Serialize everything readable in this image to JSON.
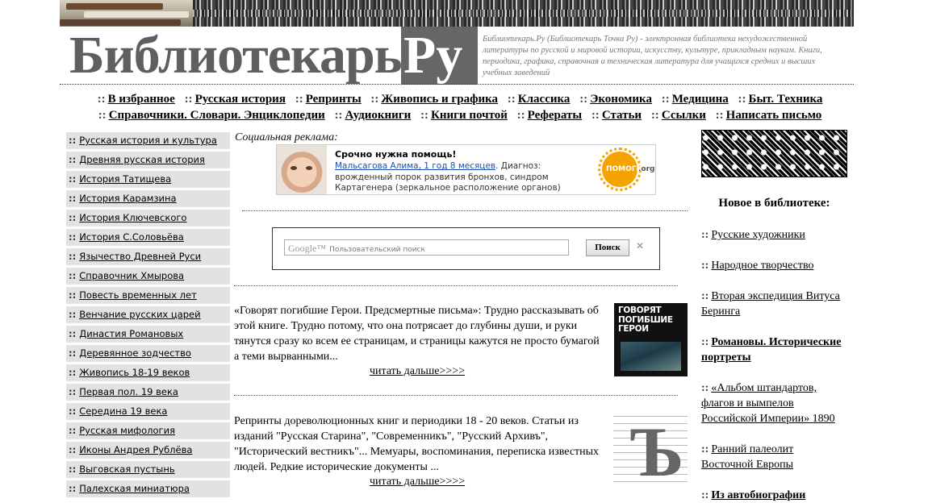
{
  "header": {
    "logo_text": "Библиотекарь.",
    "logo_suffix": "Ру",
    "description": "Библиотекарь.Ру (Библиотекарь Точка Ру) - электронная библиотека нехудожественной литературы по русской и мировой истории, искусству, культуре, прикладным наукам. Книги, периодика, графика, справочная и техническая литература для учащихся средних и высших учебных заведений"
  },
  "nav": {
    "separator": "::",
    "row1": [
      "В избранное",
      "Русская история",
      "Репринты",
      "Живопись и графика",
      "Классика",
      "Экономика",
      "Медицина",
      "Быт. Техника"
    ],
    "row2": [
      "Справочники. Словари. Энциклопедии",
      "Аудиокниги",
      "Книги почтой",
      "Рефераты",
      "Статьи",
      "Ссылки",
      "Написать письмо"
    ]
  },
  "sidebar": {
    "items": [
      "Русская история и культура",
      "Древняя русская история",
      "История Татищева",
      "История Карамзина",
      "История Ключевского",
      "История С.Соловьёва",
      "Язычество Древней Руси",
      "Справочник Хмырова",
      "Повесть временных лет",
      "Венчание русских царей",
      "Династия Романовых",
      "Деревянное зодчество",
      "Живопись 18-19 веков",
      "Первая пол. 19 века",
      "Середина 19 века",
      "Русская мифология",
      "Иконы Андрея Рублёва",
      "Выговская пустынь",
      "Палехская миниатюра"
    ]
  },
  "ad": {
    "heading": "Социальная реклама:",
    "title": "Срочно нужна помощь!",
    "link": "Мальсагова Алима, 1 год 8 месяцев",
    "text": ". Диагноз: врожденный порок развития бронхов, синдром Картагенера (зеркальное расположение органов)",
    "logo_text": "ПОМОГИ",
    "logo_org": ".org"
  },
  "search": {
    "google_mark": "Google™",
    "placeholder": "Пользовательский поиск",
    "button": "Поиск",
    "clear": "✕"
  },
  "articles": [
    {
      "text": "«Говорят погибшие Герои. Предсмертные письма»: Трудно рассказывать об этой книге. Трудно потому, что она потрясает до глубины души, и руки тянутся сразу ко всем ее страницам, и страницы кажутся не просто бумагой а теми вырванными...",
      "more": "читать дальше>>>>",
      "cover_title": "ГОВОРЯТ ПОГИБШИЕ ГЕРОИ"
    },
    {
      "text": "Репринты дореволюционных книг и периодики 18 - 20 веков. Статьи из изданий \"Русская Старина\", \"Современникъ\", \"Русский Архивъ\", \"Исторический вестникъ\"... Мемуары, воспоминания, переписка известных людей. Редкие исторические документы ...",
      "more": "читать дальше>>>>",
      "cover_letter": "Ъ"
    }
  ],
  "right": {
    "heading": "Новое в библиотеке:",
    "items": [
      "Русские художники",
      "Народное творчество",
      "Вторая экспедиция Витуса Беринга",
      "Романовы. Исторические портреты",
      "«Альбом штандартов, флагов и вымпелов Российской Империи» 1890",
      "Ранний палеолит Восточной Европы",
      "Из автобиографии"
    ]
  }
}
